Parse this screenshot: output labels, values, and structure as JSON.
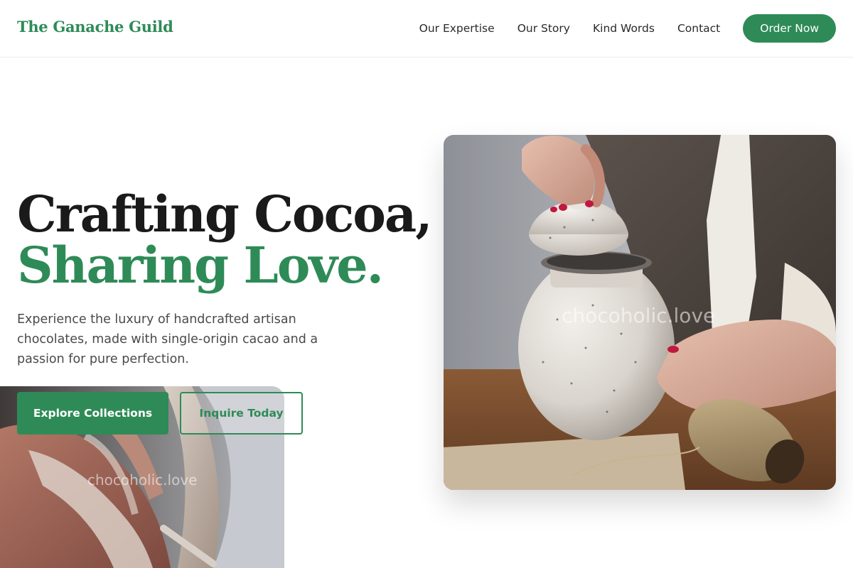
{
  "header": {
    "brand": "The Ganache Guild",
    "nav": [
      {
        "label": "Our Expertise"
      },
      {
        "label": "Our Story"
      },
      {
        "label": "Kind Words"
      },
      {
        "label": "Contact"
      }
    ],
    "cta_label": "Order Now"
  },
  "hero": {
    "title_line1": "Crafting Cocoa,",
    "title_line2": "Sharing Love.",
    "subtitle": "Experience the luxury of handcrafted artisan chocolates, made with single-origin cacao and a passion for pure perfection.",
    "primary_button": "Explore Collections",
    "secondary_button": "Inquire Today"
  },
  "images": {
    "watermark_right": "chocoholic.love",
    "watermark_left": "chocoholic.love"
  },
  "colors": {
    "accent": "#2e8b57",
    "text": "#1a1a1a",
    "muted": "#4a4a4a"
  }
}
